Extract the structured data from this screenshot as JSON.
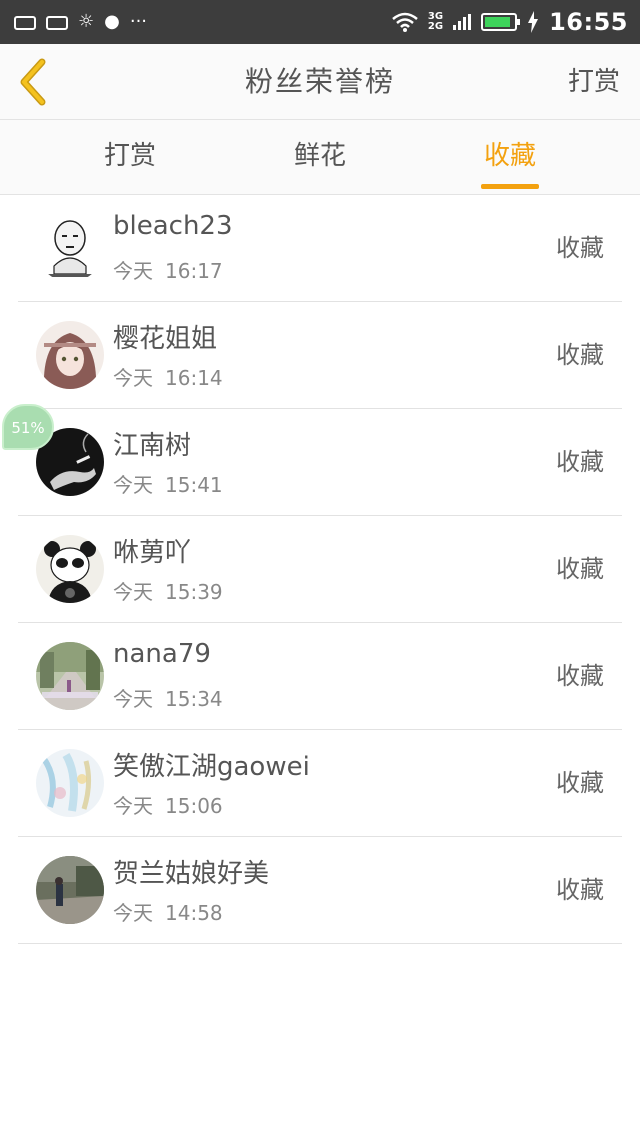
{
  "status_bar": {
    "left_icons": [
      "sim-card-icon",
      "sim-card-icon",
      "brightness-icon",
      "globe-icon",
      "more-icon"
    ],
    "more": "···",
    "net_top": "3G",
    "net_bottom": "2G",
    "battery_level": 0.9,
    "battery_color": "#3ed35b",
    "time": "16:55"
  },
  "header": {
    "title": "粉丝荣誉榜",
    "right_action": "打赏",
    "accent": "#f3a10f"
  },
  "tabs": [
    {
      "label": "打赏",
      "active": false
    },
    {
      "label": "鲜花",
      "active": false
    },
    {
      "label": "收藏",
      "active": true
    }
  ],
  "list": [
    {
      "name": "bleach23",
      "day": "今天",
      "time": "16:17",
      "action": "收藏",
      "avatar": "cartoon-face-avatar"
    },
    {
      "name": "樱花姐姐",
      "day": "今天",
      "time": "16:14",
      "action": "收藏",
      "avatar": "anime-girl-avatar"
    },
    {
      "name": "江南树",
      "day": "今天",
      "time": "15:41",
      "action": "收藏",
      "avatar": "smoking-hand-avatar"
    },
    {
      "name": "咻莮吖",
      "day": "今天",
      "time": "15:39",
      "action": "收藏",
      "avatar": "panda-avatar"
    },
    {
      "name": "nana79",
      "day": "今天",
      "time": "15:34",
      "action": "收藏",
      "avatar": "street-photo-avatar"
    },
    {
      "name": "笑傲江湖gaowei",
      "day": "今天",
      "time": "15:06",
      "action": "收藏",
      "avatar": "watercolor-avatar"
    },
    {
      "name": "贺兰姑娘好美",
      "day": "今天",
      "time": "14:58",
      "action": "收藏",
      "avatar": "outdoor-photo-avatar"
    }
  ],
  "floating_badge": {
    "text": "51%"
  }
}
